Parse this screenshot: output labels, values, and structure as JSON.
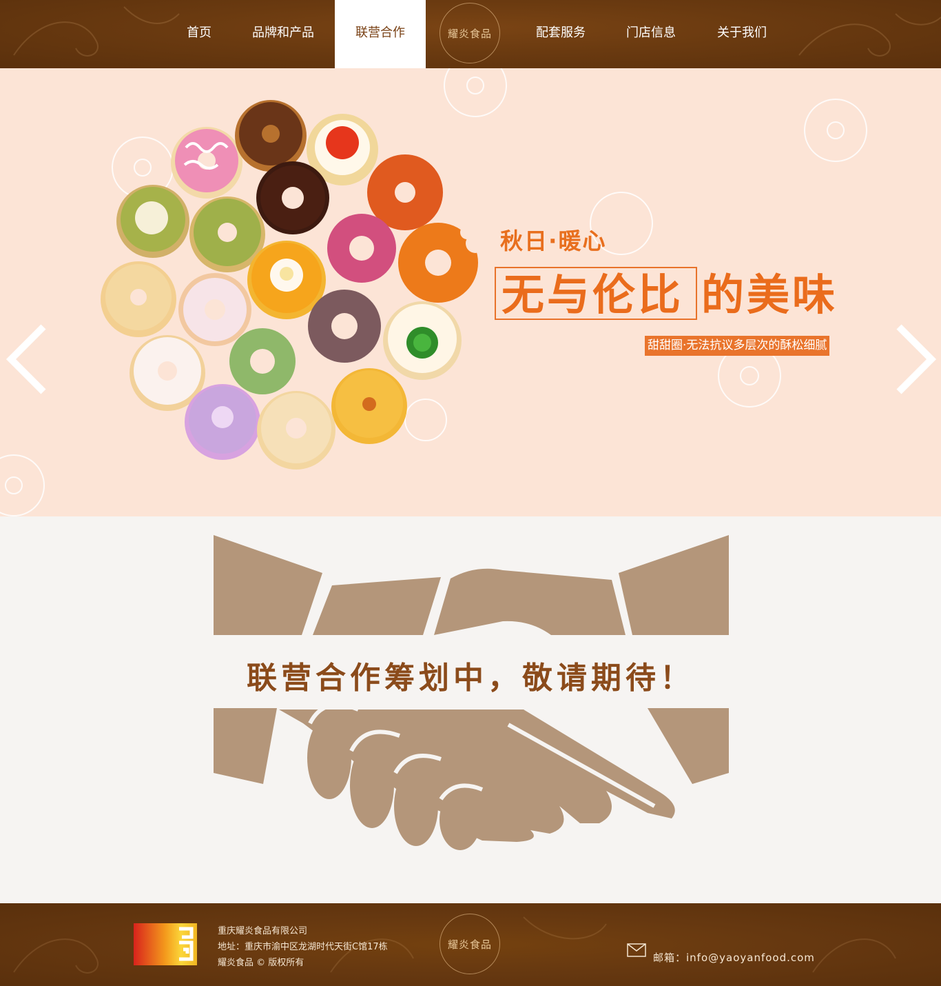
{
  "nav": {
    "items": [
      {
        "label": "首页"
      },
      {
        "label": "品牌和产品"
      },
      {
        "label": "联营合作"
      },
      {
        "label": "配套服务"
      },
      {
        "label": "门店信息"
      },
      {
        "label": "关于我们"
      }
    ],
    "active_index": 2,
    "logo_text": "耀炎食品"
  },
  "banner": {
    "slogan_small": "秋日·暖心",
    "slogan_big_boxed": "无与伦比",
    "slogan_big_rest": "的美味",
    "tagline": "甜甜圈·无法抗议多层次的酥松细腻",
    "prev_icon": "chevron-left-icon",
    "next_icon": "chevron-right-icon"
  },
  "main": {
    "title": "联营合作筹划中，敬请期待！",
    "illustration": "handshake-illustration"
  },
  "footer": {
    "company": "重庆耀炎食品有限公司",
    "address": "地址：重庆市渝中区龙湖时代天街C馆17栋",
    "copyright": "耀炎食品 © 版权所有",
    "logo_text": "耀炎食品",
    "email": "邮箱：info@yaoyanfood.com"
  },
  "colors": {
    "header_bg": "#6a3a10",
    "banner_bg": "#fce4d6",
    "accent_orange": "#ea6c1c",
    "handshake": "#b4967a",
    "title_brown": "#8b4b1b",
    "main_bg": "#f6f4f2"
  }
}
